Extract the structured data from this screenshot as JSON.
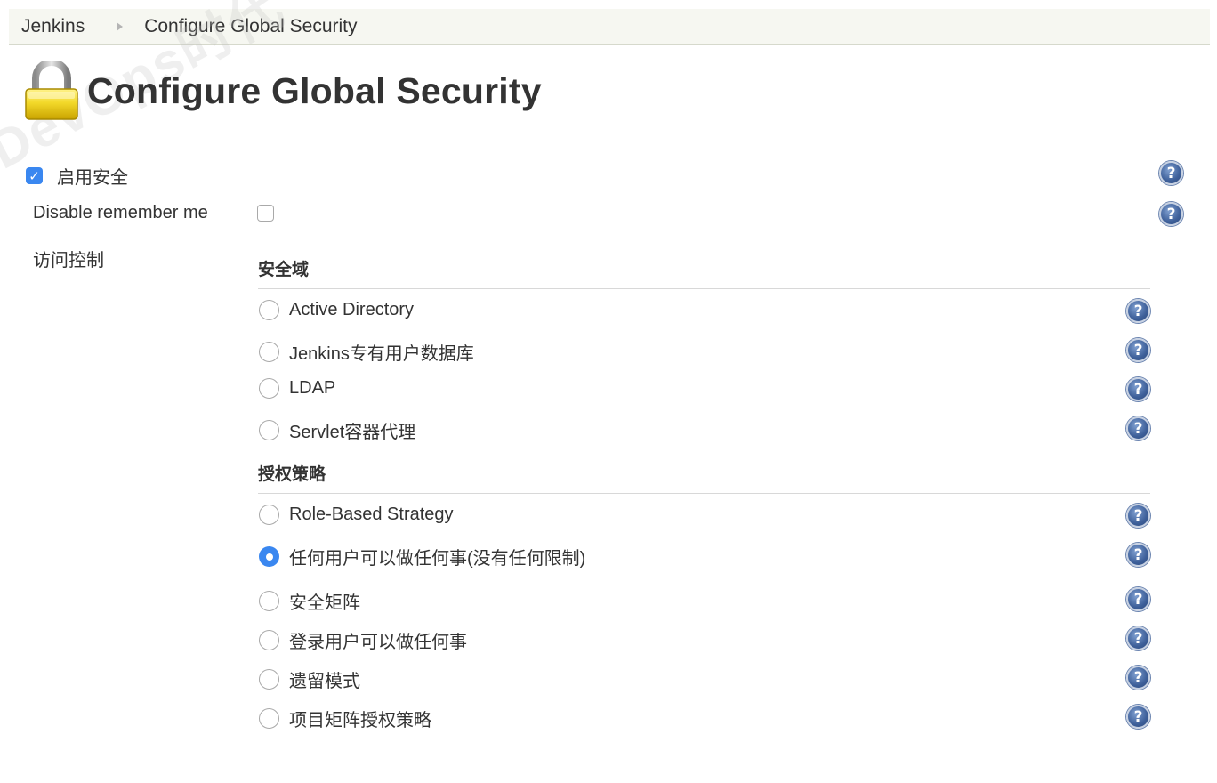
{
  "breadcrumb": {
    "items": [
      "Jenkins",
      "Configure Global Security"
    ]
  },
  "watermark": "DevOps时代",
  "page": {
    "title": "Configure Global Security",
    "title_icon": "lock-icon"
  },
  "enable_security": {
    "label": "启用安全",
    "checked": true
  },
  "disable_remember_me": {
    "label": "Disable remember me",
    "checked": false
  },
  "access_control": {
    "label": "访问控制"
  },
  "security_realm": {
    "heading": "安全域",
    "options": [
      {
        "label": "Active Directory",
        "selected": false
      },
      {
        "label": "Jenkins专有用户数据库",
        "selected": false
      },
      {
        "label": "LDAP",
        "selected": false
      },
      {
        "label": "Servlet容器代理",
        "selected": false
      }
    ]
  },
  "authorization": {
    "heading": "授权策略",
    "options": [
      {
        "label": "Role-Based Strategy",
        "selected": false
      },
      {
        "label": "任何用户可以做任何事(没有任何限制)",
        "selected": true
      },
      {
        "label": "安全矩阵",
        "selected": false
      },
      {
        "label": "登录用户可以做任何事",
        "selected": false
      },
      {
        "label": "遗留模式",
        "selected": false
      },
      {
        "label": "项目矩阵授权策略",
        "selected": false
      }
    ]
  },
  "help_icon_glyph": "?",
  "colors": {
    "accent": "#3a87f0",
    "breadcrumb_bg": "#f6f7f1",
    "help_icon": "#3d5f99",
    "text": "#333333"
  }
}
